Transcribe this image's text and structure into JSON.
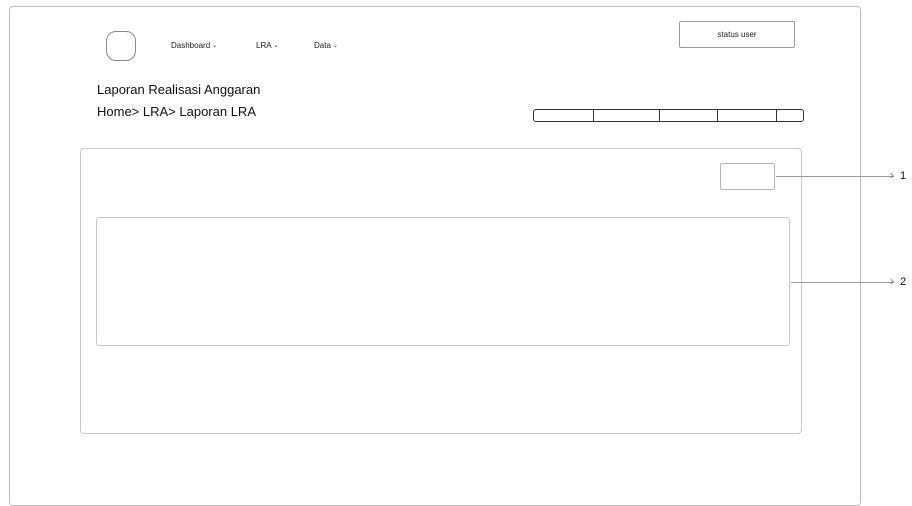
{
  "header": {
    "nav": [
      {
        "label": "Dashboard"
      },
      {
        "label": "LRA"
      },
      {
        "label": "Data"
      }
    ],
    "status_user": "status user"
  },
  "page": {
    "title": "Laporan Realisasi Anggaran",
    "breadcrumb": "Home> LRA> Laporan LRA"
  },
  "callouts": [
    "1",
    "2"
  ]
}
